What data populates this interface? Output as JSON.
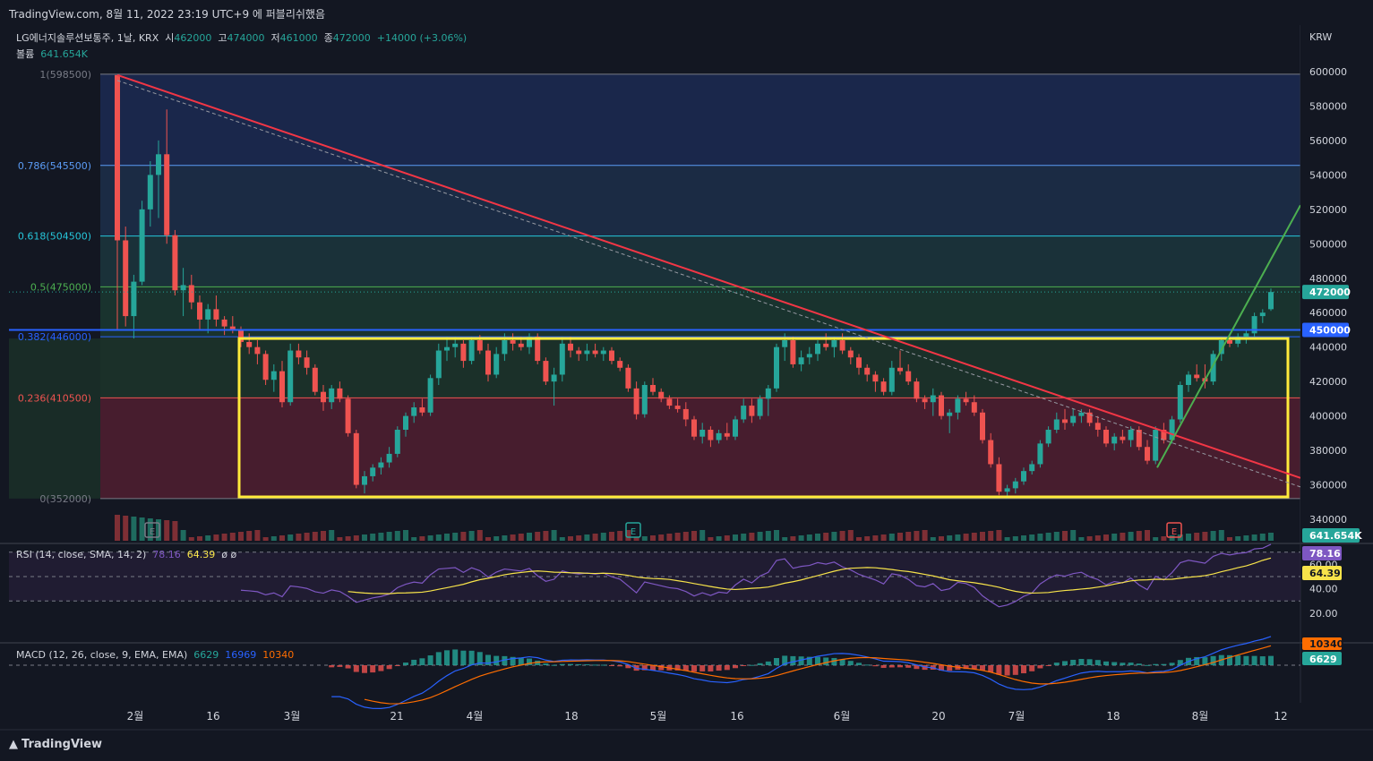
{
  "header": {
    "source": "TradingView.com, 8월 11, 2022 23:19 UTC+9 에 퍼블리쉬했음"
  },
  "legend": {
    "symbol": "LG에너지솔루션보통주, 1날, KRX",
    "o_label": "시",
    "o": "462000",
    "h_label": "고",
    "h": "474000",
    "l_label": "저",
    "l": "461000",
    "c_label": "종",
    "c": "472000",
    "change": "+14000 (+3.06%)",
    "volume_label": "볼륨",
    "volume": "641.654K"
  },
  "price_axis": {
    "currency": "KRW",
    "ticks": [
      "600000",
      "580000",
      "560000",
      "540000",
      "520000",
      "500000",
      "480000",
      "460000",
      "440000",
      "420000",
      "400000",
      "380000",
      "360000",
      "340000"
    ]
  },
  "price_badges": {
    "last": "472000",
    "line": "450000",
    "volume": "641.654K"
  },
  "fib_labels": [
    "1(598500)",
    "0.786(545500)",
    "0.618(504500)",
    "0.5(475000)",
    "0.382(446000)",
    "0.236(410500)",
    "0(352000)"
  ],
  "time_axis": [
    "2월",
    "16",
    "3월",
    "21",
    "4월",
    "18",
    "5월",
    "16",
    "6월",
    "20",
    "7월",
    "18",
    "8월",
    "12"
  ],
  "earnings_markers": [
    "E",
    "E",
    "E"
  ],
  "rsi": {
    "title": "RSI (14, close, SMA, 14, 2)",
    "rsi": "78.16",
    "sma": "64.39",
    "extra": "ø ø",
    "ticks": [
      "60.00",
      "40.00",
      "20.00"
    ]
  },
  "macd": {
    "title": "MACD (12, 26, close, 9, EMA, EMA)",
    "hist": "6629",
    "macd": "16969",
    "signal": "10340"
  },
  "footer": {
    "brand": "TradingView"
  },
  "colors": {
    "up": "#26a69a",
    "down": "#ef5350",
    "trend_red": "#f23645",
    "trend_green": "#4caf50",
    "box": "#ffeb3b",
    "hline": "#2962ff"
  },
  "chart_data": {
    "type": "candlestick",
    "ylim": [
      330000,
      610000
    ],
    "candles": [
      [
        598000,
        598000,
        450000,
        502000
      ],
      [
        502000,
        510000,
        452000,
        458000
      ],
      [
        458000,
        482000,
        445000,
        478000
      ],
      [
        478000,
        525000,
        476000,
        520000
      ],
      [
        520000,
        548000,
        510000,
        540000
      ],
      [
        540000,
        560000,
        515000,
        552000
      ],
      [
        552000,
        578000,
        500000,
        505000
      ],
      [
        505000,
        508000,
        470000,
        473000
      ],
      [
        473000,
        486000,
        458000,
        476000
      ],
      [
        476000,
        482000,
        462000,
        466000
      ],
      [
        466000,
        470000,
        450000,
        456000
      ],
      [
        456000,
        465000,
        448000,
        462000
      ],
      [
        462000,
        470000,
        452000,
        456000
      ],
      [
        456000,
        458000,
        447000,
        452000
      ],
      [
        452000,
        458000,
        448000,
        450000
      ],
      [
        450000,
        452000,
        440000,
        443000
      ],
      [
        443000,
        448000,
        436000,
        440000
      ],
      [
        440000,
        444000,
        430000,
        436000
      ],
      [
        436000,
        438000,
        418000,
        421000
      ],
      [
        421000,
        430000,
        414000,
        426000
      ],
      [
        426000,
        432000,
        405000,
        408000
      ],
      [
        408000,
        442000,
        406000,
        438000
      ],
      [
        438000,
        442000,
        430000,
        434000
      ],
      [
        434000,
        438000,
        424000,
        428000
      ],
      [
        428000,
        430000,
        412000,
        414000
      ],
      [
        414000,
        418000,
        403000,
        408000
      ],
      [
        408000,
        418000,
        404000,
        416000
      ],
      [
        416000,
        420000,
        408000,
        410000
      ],
      [
        410000,
        412000,
        388000,
        390000
      ],
      [
        390000,
        392000,
        358000,
        360000
      ],
      [
        360000,
        368000,
        355000,
        365000
      ],
      [
        365000,
        372000,
        362000,
        370000
      ],
      [
        370000,
        376000,
        366000,
        373000
      ],
      [
        373000,
        382000,
        370000,
        378000
      ],
      [
        378000,
        394000,
        376000,
        392000
      ],
      [
        392000,
        402000,
        388000,
        400000
      ],
      [
        400000,
        408000,
        396000,
        405000
      ],
      [
        405000,
        410000,
        400000,
        402000
      ],
      [
        402000,
        424000,
        400000,
        422000
      ],
      [
        422000,
        442000,
        418000,
        438000
      ],
      [
        438000,
        446000,
        432000,
        440000
      ],
      [
        440000,
        446000,
        434000,
        442000
      ],
      [
        442000,
        444000,
        428000,
        432000
      ],
      [
        432000,
        446000,
        430000,
        444000
      ],
      [
        444000,
        447000,
        436000,
        438000
      ],
      [
        438000,
        442000,
        420000,
        424000
      ],
      [
        424000,
        440000,
        422000,
        436000
      ],
      [
        436000,
        448000,
        432000,
        444000
      ],
      [
        444000,
        448000,
        438000,
        442000
      ],
      [
        442000,
        446000,
        438000,
        440000
      ],
      [
        440000,
        448000,
        436000,
        446000
      ],
      [
        446000,
        448000,
        430000,
        432000
      ],
      [
        432000,
        434000,
        418000,
        420000
      ],
      [
        420000,
        428000,
        406000,
        424000
      ],
      [
        424000,
        446000,
        420000,
        442000
      ],
      [
        442000,
        446000,
        434000,
        438000
      ],
      [
        438000,
        440000,
        432000,
        436000
      ],
      [
        436000,
        442000,
        432000,
        438000
      ],
      [
        438000,
        442000,
        434000,
        436000
      ],
      [
        436000,
        440000,
        432000,
        438000
      ],
      [
        438000,
        440000,
        430000,
        432000
      ],
      [
        432000,
        434000,
        426000,
        428000
      ],
      [
        428000,
        430000,
        414000,
        416000
      ],
      [
        416000,
        420000,
        398000,
        401000
      ],
      [
        401000,
        420000,
        399000,
        418000
      ],
      [
        418000,
        422000,
        412000,
        414000
      ],
      [
        414000,
        416000,
        408000,
        410000
      ],
      [
        410000,
        412000,
        404000,
        406000
      ],
      [
        406000,
        410000,
        402000,
        404000
      ],
      [
        404000,
        408000,
        394000,
        398000
      ],
      [
        398000,
        400000,
        386000,
        388000
      ],
      [
        388000,
        396000,
        384000,
        392000
      ],
      [
        392000,
        394000,
        382000,
        386000
      ],
      [
        386000,
        392000,
        384000,
        390000
      ],
      [
        390000,
        396000,
        386000,
        388000
      ],
      [
        388000,
        400000,
        386000,
        398000
      ],
      [
        398000,
        410000,
        396000,
        406000
      ],
      [
        406000,
        410000,
        396000,
        400000
      ],
      [
        400000,
        412000,
        398000,
        410000
      ],
      [
        410000,
        418000,
        400000,
        416000
      ],
      [
        416000,
        442000,
        414000,
        440000
      ],
      [
        440000,
        448000,
        432000,
        444000
      ],
      [
        444000,
        446000,
        428000,
        430000
      ],
      [
        430000,
        438000,
        426000,
        434000
      ],
      [
        434000,
        440000,
        430000,
        436000
      ],
      [
        436000,
        444000,
        432000,
        442000
      ],
      [
        442000,
        448000,
        438000,
        440000
      ],
      [
        440000,
        446000,
        434000,
        444000
      ],
      [
        444000,
        448000,
        436000,
        438000
      ],
      [
        438000,
        440000,
        430000,
        434000
      ],
      [
        434000,
        436000,
        424000,
        428000
      ],
      [
        428000,
        430000,
        420000,
        424000
      ],
      [
        424000,
        426000,
        414000,
        420000
      ],
      [
        420000,
        422000,
        412000,
        414000
      ],
      [
        414000,
        432000,
        412000,
        428000
      ],
      [
        428000,
        438000,
        424000,
        426000
      ],
      [
        426000,
        430000,
        418000,
        420000
      ],
      [
        420000,
        422000,
        408000,
        410000
      ],
      [
        410000,
        412000,
        404000,
        408000
      ],
      [
        408000,
        416000,
        400000,
        412000
      ],
      [
        412000,
        414000,
        398000,
        400000
      ],
      [
        400000,
        404000,
        390000,
        402000
      ],
      [
        402000,
        412000,
        398000,
        410000
      ],
      [
        410000,
        414000,
        406000,
        408000
      ],
      [
        408000,
        412000,
        400000,
        402000
      ],
      [
        402000,
        404000,
        384000,
        386000
      ],
      [
        386000,
        390000,
        370000,
        372000
      ],
      [
        372000,
        376000,
        354000,
        356000
      ],
      [
        356000,
        360000,
        352000,
        358000
      ],
      [
        358000,
        364000,
        355000,
        362000
      ],
      [
        362000,
        370000,
        360000,
        368000
      ],
      [
        368000,
        374000,
        366000,
        372000
      ],
      [
        372000,
        386000,
        370000,
        384000
      ],
      [
        384000,
        394000,
        382000,
        392000
      ],
      [
        392000,
        402000,
        390000,
        398000
      ],
      [
        398000,
        404000,
        392000,
        396000
      ],
      [
        396000,
        404000,
        394000,
        400000
      ],
      [
        400000,
        404000,
        396000,
        402000
      ],
      [
        402000,
        404000,
        394000,
        396000
      ],
      [
        396000,
        400000,
        388000,
        392000
      ],
      [
        392000,
        394000,
        382000,
        384000
      ],
      [
        384000,
        390000,
        380000,
        388000
      ],
      [
        388000,
        392000,
        384000,
        386000
      ],
      [
        386000,
        394000,
        382000,
        392000
      ],
      [
        392000,
        394000,
        380000,
        382000
      ],
      [
        382000,
        386000,
        372000,
        374000
      ],
      [
        374000,
        394000,
        372000,
        392000
      ],
      [
        392000,
        396000,
        384000,
        386000
      ],
      [
        386000,
        400000,
        384000,
        398000
      ],
      [
        398000,
        420000,
        396000,
        418000
      ],
      [
        418000,
        426000,
        414000,
        424000
      ],
      [
        424000,
        430000,
        420000,
        422000
      ],
      [
        422000,
        430000,
        416000,
        420000
      ],
      [
        420000,
        438000,
        418000,
        436000
      ],
      [
        436000,
        446000,
        432000,
        444000
      ],
      [
        444000,
        446000,
        440000,
        442000
      ],
      [
        442000,
        448000,
        440000,
        446000
      ],
      [
        446000,
        450000,
        442000,
        448000
      ],
      [
        448000,
        460000,
        446000,
        458000
      ],
      [
        458000,
        462000,
        454000,
        460000
      ],
      [
        462000,
        474000,
        461000,
        472000
      ]
    ],
    "volume_last": "641.654K",
    "trendlines": [
      {
        "name": "descending",
        "from": [
          0,
          598000
        ],
        "to": [
          139,
          364000
        ]
      },
      {
        "name": "ascending",
        "from": [
          128,
          370000
        ],
        "to": [
          139,
          460000
        ]
      }
    ],
    "range_box": {
      "top": 445000,
      "bottom": 353000
    },
    "fib": [
      [
        1,
        598500
      ],
      [
        0.786,
        545500
      ],
      [
        0.618,
        504500
      ],
      [
        0.5,
        475000
      ],
      [
        0.382,
        446000
      ],
      [
        0.236,
        410500
      ],
      [
        0,
        352000
      ]
    ],
    "horizontal_line": 450000,
    "rsi_last": 78.16,
    "rsi_sma_last": 64.39,
    "macd_last": 16969,
    "signal_last": 10340,
    "hist_last": 6629
  }
}
